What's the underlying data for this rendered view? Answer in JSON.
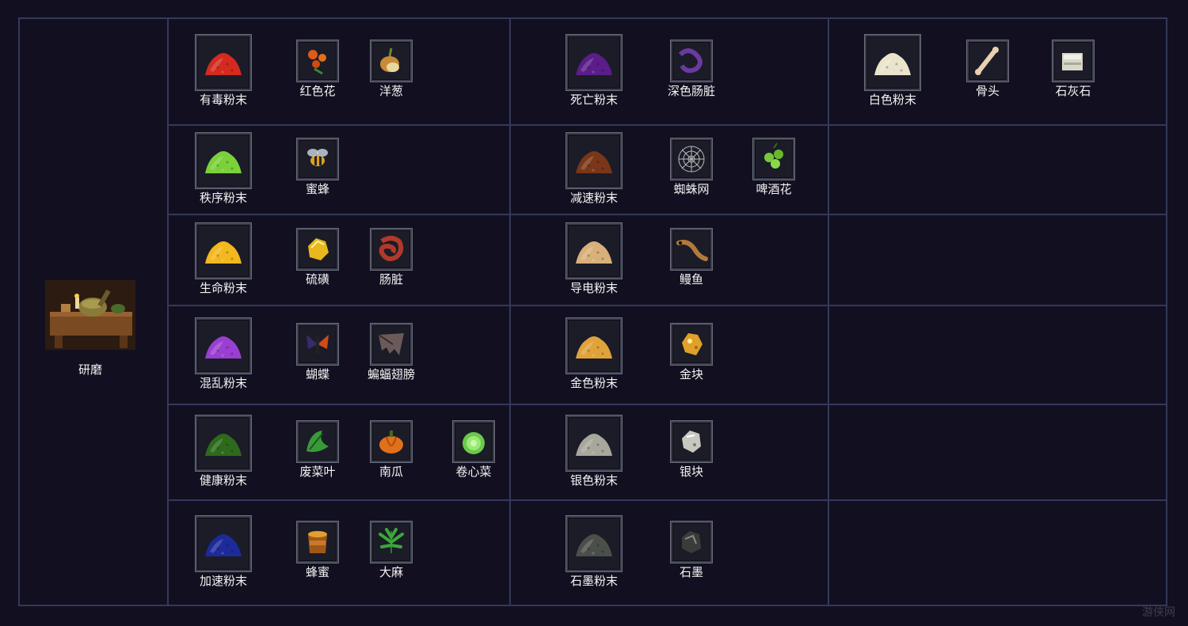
{
  "station": {
    "label": "研磨",
    "icon": "grinding-station-icon"
  },
  "colors": {
    "background": "#121020",
    "grid": "#34385a",
    "slot_border": "#6a6d7d"
  },
  "recipes": [
    {
      "powder": {
        "label": "有毒粉末",
        "color": "#d42a1f"
      },
      "ingredients": [
        {
          "label": "红色花",
          "icon": "red-flower-icon"
        },
        {
          "label": "洋葱",
          "icon": "onion-icon"
        }
      ]
    },
    {
      "powder": {
        "label": "死亡粉末",
        "color": "#5a1d8a"
      },
      "ingredients": [
        {
          "label": "深色肠脏",
          "icon": "dark-guts-icon"
        }
      ]
    },
    {
      "powder": {
        "label": "白色粉末",
        "color": "#eae4cc"
      },
      "ingredients": [
        {
          "label": "骨头",
          "icon": "bone-icon"
        },
        {
          "label": "石灰石",
          "icon": "limestone-icon"
        }
      ]
    },
    {
      "powder": {
        "label": "秩序粉末",
        "color": "#7bd13a"
      },
      "ingredients": [
        {
          "label": "蜜蜂",
          "icon": "bee-icon"
        }
      ]
    },
    {
      "powder": {
        "label": "减速粉末",
        "color": "#7a3618"
      },
      "ingredients": [
        {
          "label": "蜘蛛网",
          "icon": "spider-web-icon"
        },
        {
          "label": "啤酒花",
          "icon": "hops-icon"
        }
      ]
    },
    {
      "powder": {
        "label": "生命粉末",
        "color": "#f2b81e"
      },
      "ingredients": [
        {
          "label": "硫磺",
          "icon": "sulfur-icon"
        },
        {
          "label": "肠脏",
          "icon": "guts-icon"
        }
      ]
    },
    {
      "powder": {
        "label": "导电粉末",
        "color": "#d9b07a"
      },
      "ingredients": [
        {
          "label": "鳗鱼",
          "icon": "eel-icon"
        }
      ]
    },
    {
      "powder": {
        "label": "混乱粉末",
        "color": "#9a3fd1"
      },
      "ingredients": [
        {
          "label": "蝴蝶",
          "icon": "butterfly-icon"
        },
        {
          "label": "蝙蝠翅膀",
          "icon": "bat-wing-icon"
        }
      ]
    },
    {
      "powder": {
        "label": "金色粉末",
        "color": "#e0a23a"
      },
      "ingredients": [
        {
          "label": "金块",
          "icon": "gold-nugget-icon"
        }
      ]
    },
    {
      "powder": {
        "label": "健康粉末",
        "color": "#2e6a1c"
      },
      "ingredients": [
        {
          "label": "废菜叶",
          "icon": "vegetable-scraps-icon"
        },
        {
          "label": "南瓜",
          "icon": "pumpkin-icon"
        },
        {
          "label": "卷心菜",
          "icon": "cabbage-icon"
        }
      ]
    },
    {
      "powder": {
        "label": "银色粉末",
        "color": "#a7a79c"
      },
      "ingredients": [
        {
          "label": "银块",
          "icon": "silver-nugget-icon"
        }
      ]
    },
    {
      "powder": {
        "label": "加速粉末",
        "color": "#1d2a9a"
      },
      "ingredients": [
        {
          "label": "蜂蜜",
          "icon": "honey-icon"
        },
        {
          "label": "大麻",
          "icon": "hemp-icon"
        }
      ]
    },
    {
      "powder": {
        "label": "石墨粉末",
        "color": "#4a4f4a"
      },
      "ingredients": [
        {
          "label": "石墨",
          "icon": "graphite-icon"
        }
      ]
    }
  ]
}
